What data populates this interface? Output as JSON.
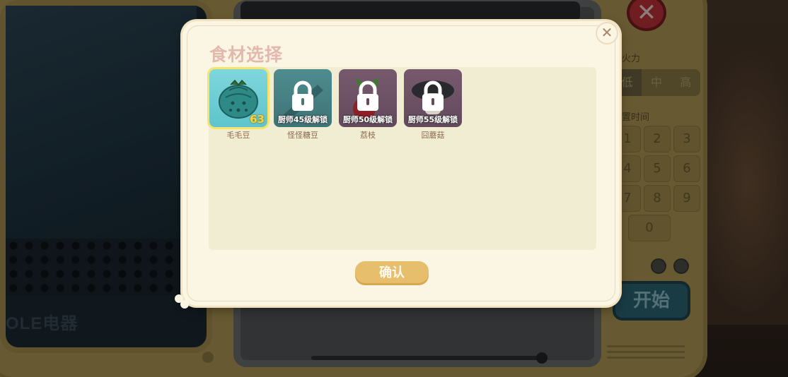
{
  "background": {
    "brand_text": "OLE电器",
    "fire_label": "择火力",
    "fire_options": [
      "低",
      "中",
      "高"
    ],
    "time_label": "设置时间",
    "keypad": [
      "1",
      "2",
      "3",
      "4",
      "5",
      "6",
      "7",
      "8",
      "9",
      "0"
    ],
    "start_label": "开始",
    "close_symbol": "✕"
  },
  "modal": {
    "title": "食材选择",
    "close_symbol": "✕",
    "confirm_label": "确认",
    "items": [
      {
        "name": "毛毛豆",
        "count": "63",
        "locked": false,
        "selected": true,
        "icon": "fuzzy-bean-icon"
      },
      {
        "name": "怪怪糖豆",
        "lock_text": "厨师45级解锁",
        "locked": true,
        "icon": "lock-icon"
      },
      {
        "name": "荔枝",
        "lock_text": "厨师50级解锁",
        "locked": true,
        "icon": "lock-icon"
      },
      {
        "name": "囧蘑菇",
        "lock_text": "厨师55级解锁",
        "locked": true,
        "icon": "lock-icon"
      }
    ]
  },
  "colors": {
    "modal_bg": "#fbf5e3",
    "title": "#e2b9ad",
    "confirm": "#e7be6b",
    "selected_border": "#f6e36a"
  }
}
